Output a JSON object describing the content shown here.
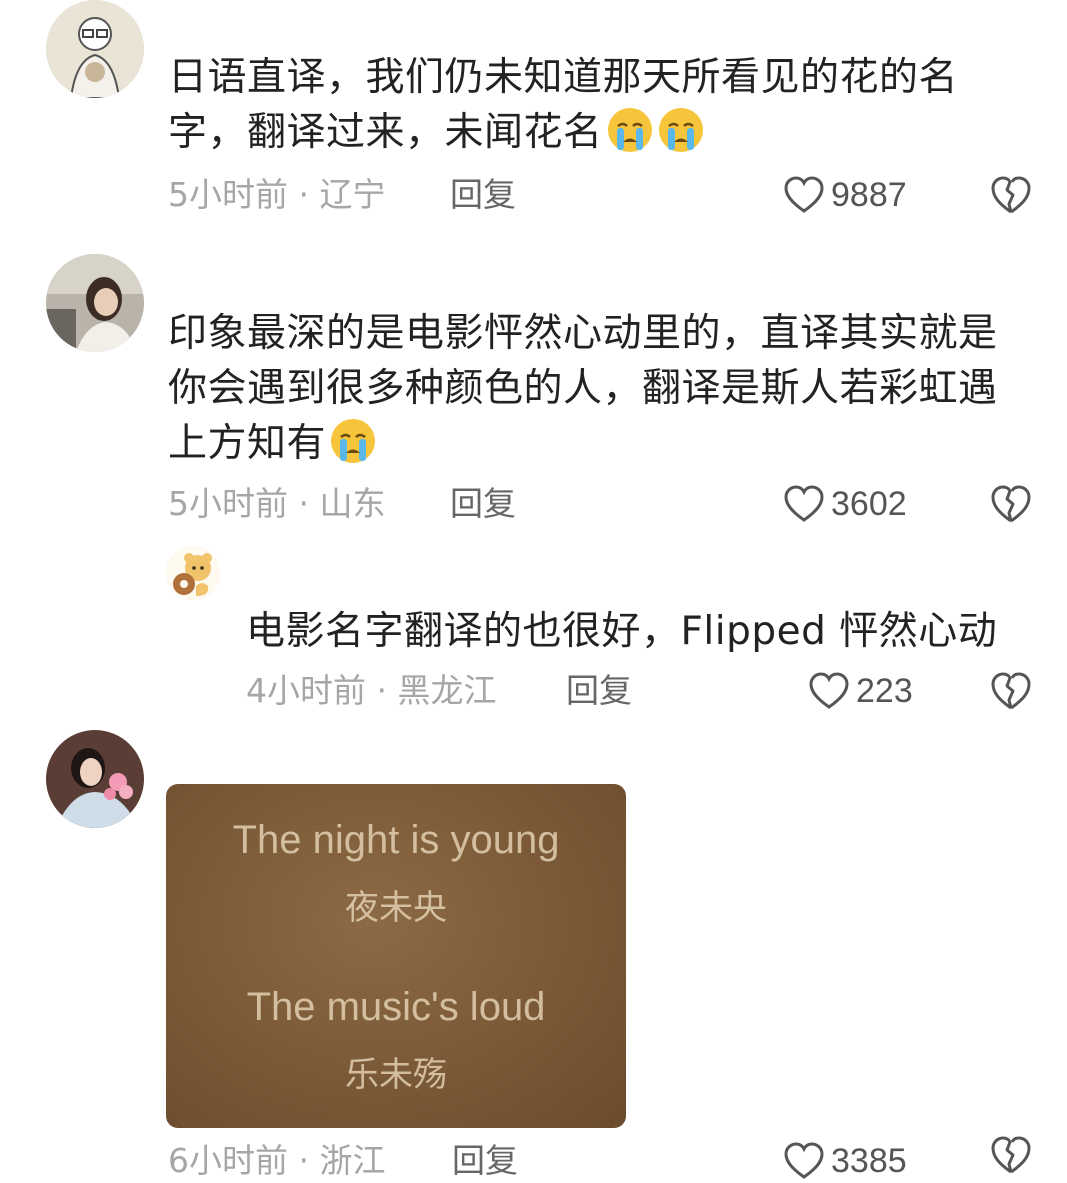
{
  "comments": [
    {
      "text": "日语直译，我们仍未知道那天所看见的花的名字，翻译过来，未闻花名",
      "emoji": "crying-emoji",
      "time": "5小时前",
      "location": "辽宁",
      "reply_label": "回复",
      "likes": "9887"
    },
    {
      "text": "印象最深的是电影怦然心动里的，直译其实就是你会遇到很多种颜色的人，翻译是斯人若彩虹遇上方知有",
      "emoji": "crying-emoji",
      "time": "5小时前",
      "location": "山东",
      "reply_label": "回复",
      "likes": "3602"
    },
    {
      "text": "电影名字翻译的也很好，Flipped 怦然心动",
      "time": "4小时前",
      "location": "黑龙江",
      "reply_label": "回复",
      "likes": "223"
    },
    {
      "image_lines": {
        "line1_en": "The night is young",
        "line1_zh": "夜未央",
        "line2_en": "The music's loud",
        "line2_zh": "乐未殇"
      },
      "time": "6小时前",
      "location": "浙江",
      "reply_label": "回复",
      "likes": "3385"
    }
  ],
  "separator": "·",
  "colors": {
    "meta": "#a6a6a6",
    "text": "#222222",
    "image_bg": "#7a5936"
  }
}
